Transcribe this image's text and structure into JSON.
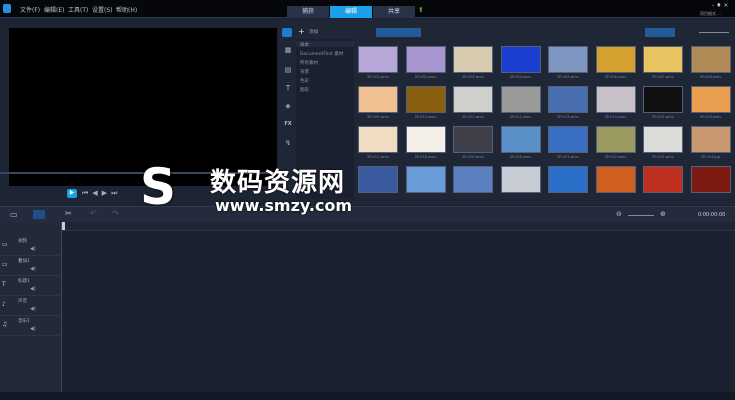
{
  "menu": [
    "文件(F)",
    "编辑(E)",
    "工具(T)",
    "设置(S)",
    "帮助(H)"
  ],
  "tabs": [
    {
      "label": "捕获",
      "active": false
    },
    {
      "label": "编辑",
      "active": true
    },
    {
      "label": "共享",
      "active": false
    }
  ],
  "window_controls": "- ♦ ×",
  "project_info": "项目格式 ...",
  "library": {
    "add_label": "添加",
    "categories": [
      "样本",
      "DocumentFirst 素材",
      "所有素材",
      "背景",
      "色彩",
      "图形"
    ],
    "thumbnails": [
      {
        "label": "SP-V01.wmv",
        "color": "#b7a6d8"
      },
      {
        "label": "SP-V02.wmv",
        "color": "#a896d0"
      },
      {
        "label": "SP-V03.wmv",
        "color": "#d8ccb0"
      },
      {
        "label": "SP-V04.wmv",
        "color": "#1d3fd0"
      },
      {
        "label": "SP-V05.wmv",
        "color": "#7f97c0"
      },
      {
        "label": "SP-V06.wmv",
        "color": "#d4a030"
      },
      {
        "label": "SP-V07.wmv",
        "color": "#e7c460"
      },
      {
        "label": "SP-V08.wmv",
        "color": "#b08a55"
      },
      {
        "label": "SP-V09.wmv",
        "color": "#f0c090"
      },
      {
        "label": "SP-V10.wmv",
        "color": "#8a6010"
      },
      {
        "label": "SP-V11.wmv",
        "color": "#cfd0cc"
      },
      {
        "label": "SP-V12.wmv",
        "color": "#9a9a98"
      },
      {
        "label": "SP-V13.wmv",
        "color": "#4a6fb0"
      },
      {
        "label": "SP-V14.wmv",
        "color": "#c8c0c8"
      },
      {
        "label": "SP-V15.wmv",
        "color": "#101010"
      },
      {
        "label": "SP-V16.wmv",
        "color": "#e8a050"
      },
      {
        "label": "SP-V17.wmv",
        "color": "#f0dcc0"
      },
      {
        "label": "SP-V18.wmv",
        "color": "#f4f0e8"
      },
      {
        "label": "SP-V19.wmv",
        "color": "#40404a"
      },
      {
        "label": "SP-V20.wmv",
        "color": "#5a90c8"
      },
      {
        "label": "SP-V21.wmv",
        "color": "#3a6ec0"
      },
      {
        "label": "SP-V22.wmv",
        "color": "#9a9a60"
      },
      {
        "label": "SP-V23.wmv",
        "color": "#dcdcd8"
      },
      {
        "label": "SP-V24.jpg",
        "color": "#c89870"
      },
      {
        "label": "",
        "color": "#3a5aa0"
      },
      {
        "label": "",
        "color": "#6a9ad8"
      },
      {
        "label": "",
        "color": "#5a80c0"
      },
      {
        "label": "",
        "color": "#c8ccd4"
      },
      {
        "label": "",
        "color": "#2a70c8"
      },
      {
        "label": "",
        "color": "#d06020"
      },
      {
        "label": "",
        "color": "#c03020"
      },
      {
        "label": "",
        "color": "#7a1a10"
      }
    ]
  },
  "timecode": "0:00:00:00",
  "tracks": [
    "视频",
    "叠加1",
    "标题1",
    "声音",
    "音乐1"
  ],
  "watermark": {
    "text": "数码资源网",
    "url": "www.smzy.com"
  },
  "colors": {
    "accent": "#1aa0e6",
    "background": "#1b2130"
  }
}
